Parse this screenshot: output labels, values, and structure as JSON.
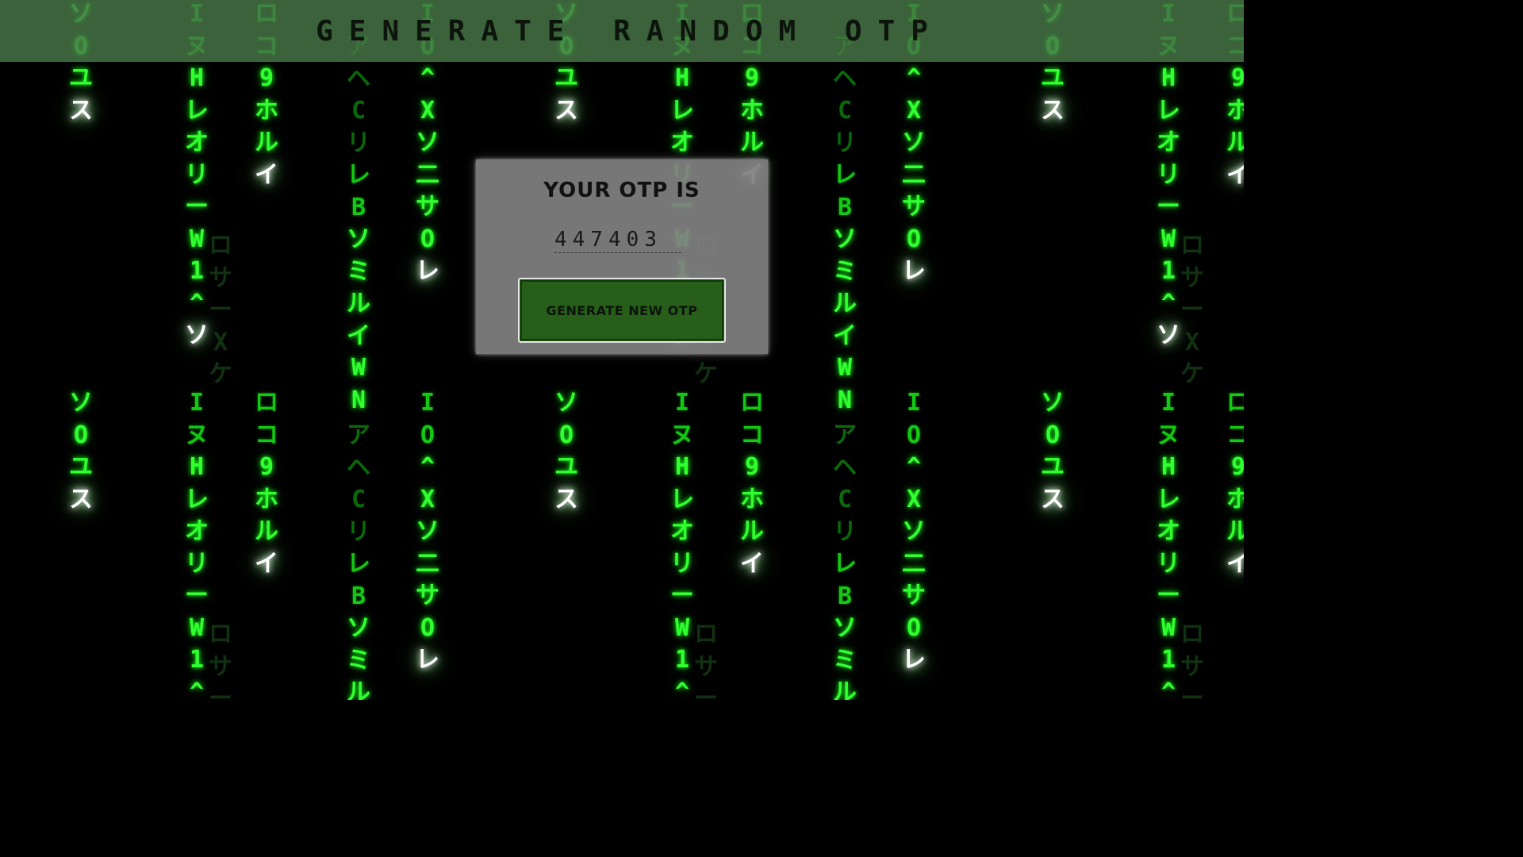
{
  "header": {
    "title": "Generate Random OTP"
  },
  "otp_card": {
    "heading": "Your OTP is",
    "otp_value": "447403",
    "button_label": "Generate New OTP"
  },
  "colors": {
    "background": "#000000",
    "rain_bright": "#32ff32",
    "rain_head": "#ffffff",
    "header_band": "#487848",
    "card": "#808080",
    "button": "#275e19"
  },
  "rain": {
    "glyph_set": "ソ0ユス Iヌ Hレオリー W1^ソ ロコ9ホルイ アヘCリレBソミルイWN IO^Xソ二サOレ"
  }
}
